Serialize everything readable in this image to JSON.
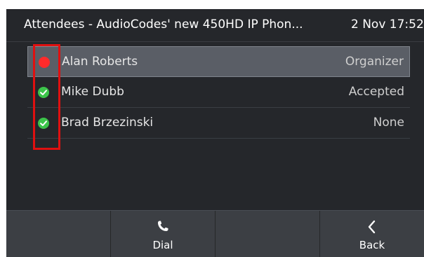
{
  "header": {
    "title": "Attendees - AudioCodes' new 450HD IP Phon...",
    "time": "2 Nov 17:52"
  },
  "attendees": [
    {
      "name": "Alan Roberts",
      "role": "Organizer",
      "status_color": "#ff2b2b",
      "status": "red-dot"
    },
    {
      "name": "Mike Dubb",
      "role": "Accepted",
      "status_color": "#3cc44a",
      "status": "check-icon"
    },
    {
      "name": "Brad Brzezinski",
      "role": "None",
      "status_color": "#3cc44a",
      "status": "check-icon"
    }
  ],
  "softkeys": [
    {
      "label": "",
      "icon": ""
    },
    {
      "label": "Dial",
      "icon": "phone-icon"
    },
    {
      "label": "",
      "icon": ""
    },
    {
      "label": "Back",
      "icon": "back-chevron-icon"
    }
  ],
  "colors": {
    "screen_bg": "#25272b",
    "selected_row": "#5a5e66",
    "annotation_red": "#e01010"
  }
}
